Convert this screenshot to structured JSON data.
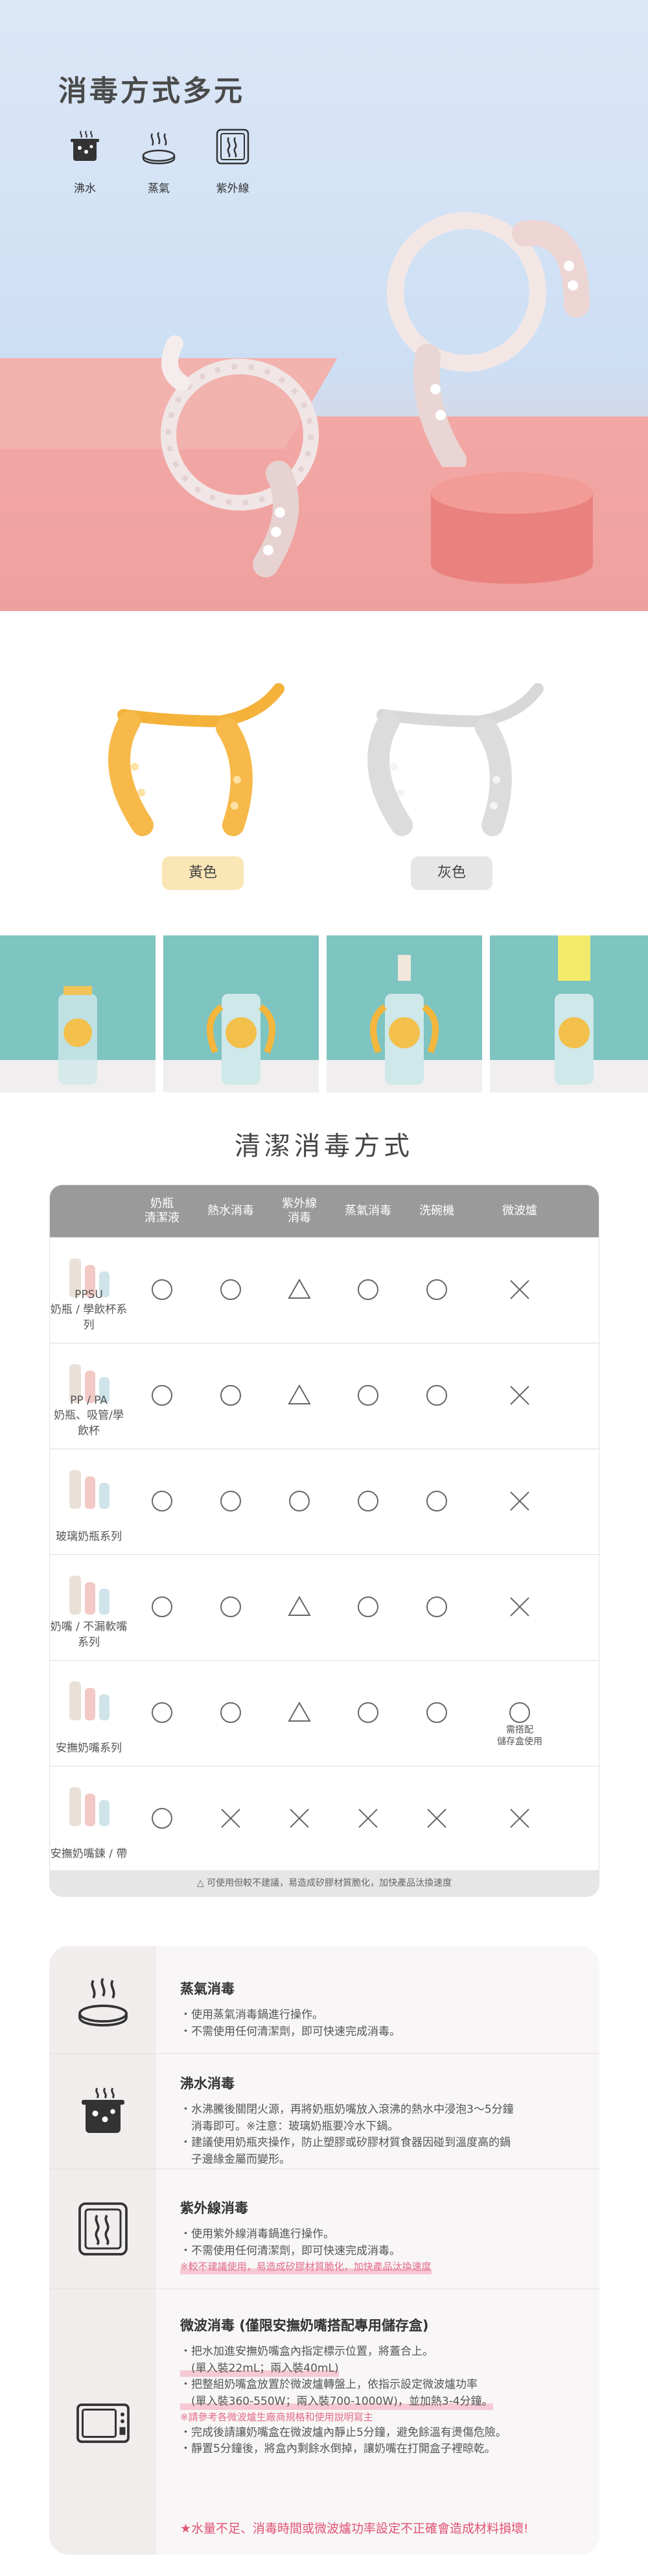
{
  "hero": {
    "title": "消毒方式多元",
    "methods": [
      {
        "label": "沸水",
        "icon": "boiling-pot-icon"
      },
      {
        "label": "蒸氣",
        "icon": "steam-icon"
      },
      {
        "label": "紫外線",
        "icon": "uv-lamp-icon"
      }
    ]
  },
  "colors": {
    "yellow_label": "黃色",
    "gray_label": "灰色"
  },
  "cleaning": {
    "title": "清潔消毒方式",
    "columns": [
      "奶瓶\n清潔液",
      "熱水消毒",
      "紫外線\n消毒",
      "蒸氣消毒",
      "洗碗機",
      "微波爐"
    ],
    "rows": [
      {
        "label": "PPSU\n奶瓶 / 學飲杯系列",
        "marks": [
          "circle",
          "circle",
          "triangle",
          "circle",
          "circle",
          "cross"
        ],
        "note": ""
      },
      {
        "label": "PP / PA\n奶瓶、吸管/學飲杯",
        "marks": [
          "circle",
          "circle",
          "triangle",
          "circle",
          "circle",
          "cross"
        ],
        "note": ""
      },
      {
        "label": "玻璃奶瓶系列",
        "marks": [
          "circle",
          "circle",
          "circle",
          "circle",
          "circle",
          "cross"
        ],
        "note": ""
      },
      {
        "label": "奶嘴 / 不漏軟嘴系列",
        "marks": [
          "circle",
          "circle",
          "triangle",
          "circle",
          "circle",
          "cross"
        ],
        "note": ""
      },
      {
        "label": "安撫奶嘴系列",
        "marks": [
          "circle",
          "circle",
          "triangle",
          "circle",
          "circle",
          "circle"
        ],
        "note": "需搭配\n儲存盒使用"
      },
      {
        "label": "安撫奶嘴鍊 / 帶",
        "marks": [
          "circle",
          "cross",
          "cross",
          "cross",
          "cross",
          "cross"
        ],
        "note": ""
      }
    ],
    "footnote": "△ 可使用但較不建議，易造成矽膠材質脆化，加快產品汰換速度"
  },
  "disinfect": {
    "items": [
      {
        "icon": "steam-icon",
        "title": "蒸氣消毒",
        "lines": [
          "・使用蒸氣消毒鍋進行操作。",
          "・不需使用任何清潔劑，即可快速完成消毒。"
        ]
      },
      {
        "icon": "boiling-pot-icon",
        "title": "沸水消毒",
        "lines": [
          "・水沸騰後關閉火源，再將奶瓶奶嘴放入滾沸的熱水中浸泡3～5分鐘",
          "　消毒即可。※注意：玻璃奶瓶要冷水下鍋。",
          "・建議使用奶瓶夾操作，防止塑膠或矽膠材質食器因碰到溫度高的鍋",
          "　子邊緣金屬而變形。"
        ]
      },
      {
        "icon": "uv-lamp-icon",
        "title": "紫外線消毒",
        "lines": [
          "・使用紫外線消毒鍋進行操作。",
          "・不需使用任何清潔劑，即可快速完成消毒。"
        ],
        "warning": "※較不建議使用，易造成矽膠材質脆化，加快產品汰換速度"
      },
      {
        "icon": "microwave-icon",
        "title": "微波消毒 (僅限安撫奶嘴搭配專用儲存盒)",
        "lines": [
          "・把水加進安撫奶嘴盒內指定標示位置，將蓋合上。",
          "　(單入裝22mL；兩入裝40mL)",
          "・把整組奶嘴盒放置於微波爐轉盤上，依指示設定微波爐功率",
          "　(單入裝360-550W；兩入裝700-1000W)，並加熱3-4分鐘。"
        ],
        "ref_note": "※請參考各微波爐生廠商規格和使用說明寫主",
        "lines2": [
          "・完成後請讓奶嘴盒在微波爐內靜止5分鐘，避免餘溫有燙傷危險。",
          "・靜置5分鐘後，將盒內剩餘水倒掉，讓奶嘴在打開盒子裡晾乾。"
        ],
        "warning": "★水量不足、消毒時間或微波爐功率設定不正確會造成材料損壞!"
      }
    ]
  }
}
